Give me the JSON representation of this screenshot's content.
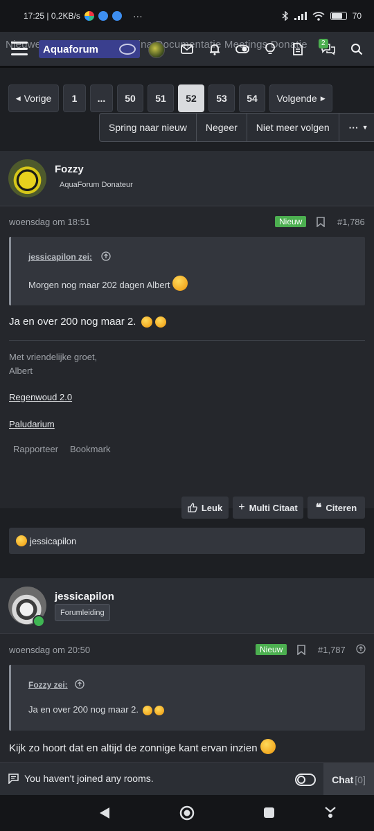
{
  "status_bar": {
    "time_speed": "17:25 | 0,2KB/s",
    "more": "···",
    "battery": "70",
    "battery_level": 0.7
  },
  "nav": {
    "ghost_text": "Nieuwe berichten    HomePagina    Documentatie    Meetings    Donatie",
    "logo_text": "Aquaforum",
    "conversations_badge": "2",
    "icons": [
      "menu-icon",
      "envelope-icon",
      "bell-icon",
      "toggle-icon",
      "lightbulb-icon",
      "document-icon",
      "chat-bubbles-icon",
      "search-icon"
    ]
  },
  "pagination": {
    "prev": "Vorige",
    "pages": [
      "1",
      "...",
      "50",
      "51",
      "52",
      "53",
      "54"
    ],
    "active": "52",
    "next": "Volgende"
  },
  "thread_actions": {
    "jump_new": "Spring naar nieuw",
    "ignore": "Negeer",
    "unfollow": "Niet meer volgen",
    "more": "···"
  },
  "posts": [
    {
      "author": "Fozzy",
      "user_title": "AquaForum Donateur",
      "date": "woensdag om 18:51",
      "new_badge": "Nieuw",
      "post_number": "#1,786",
      "quote_author": "jessicapilon zei:",
      "quote_text": "Morgen nog maar 202 dagen Albert",
      "body": "Ja en over 200 nog maar 2.",
      "signature_line1": "Met vriendelijke groet,",
      "signature_line2": "Albert",
      "sig_link1": "Regenwoud 2.0",
      "sig_link2": "Paludarium",
      "report": "Rapporteer",
      "bookmark": "Bookmark",
      "like": "Leuk",
      "multiquote": "Multi Citaat",
      "quote_btn": "Citeren",
      "reaction_user": "jessicapilon"
    },
    {
      "author": "jessicapilon",
      "role": "Forumleiding",
      "date": "woensdag om 20:50",
      "new_badge": "Nieuw",
      "post_number": "#1,787",
      "quote_author": "Fozzy zei:",
      "quote_text": "Ja en over 200 nog maar 2.",
      "body": "Kijk zo hoort dat en altijd de zonnige kant ervan inzien"
    }
  ],
  "chat": {
    "text": "You haven't joined any rooms.",
    "button": "Chat",
    "count": "[0]"
  },
  "colors": {
    "accent_new": "#4caf50",
    "page_bg": "#1d1f23",
    "panel_bg": "#2b2e34"
  }
}
